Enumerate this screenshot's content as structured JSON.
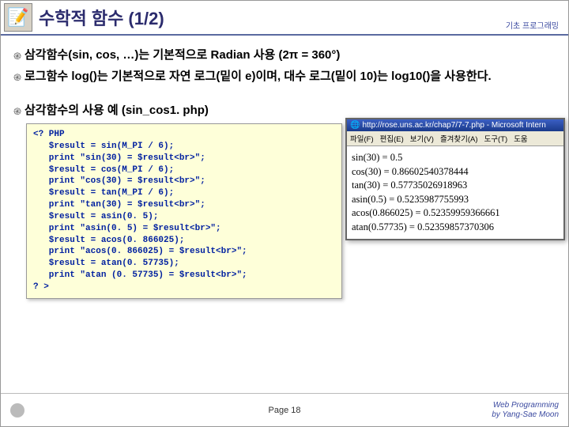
{
  "header": {
    "icon_glyph": "📝",
    "title": "수학적 함수 (1/2)",
    "subtitle": "기초 프로그래밍"
  },
  "bullets": {
    "b1": "삼각함수(sin, cos, …)는 기본적으로 Radian 사용 (2π = 360°)",
    "b2": "로그함수 log()는 기본적으로 자연 로그(밑이 e)이며, 대수 로그(밑이 10)는 log10()을 사용한다.",
    "b3": "삼각함수의 사용 예 (sin_cos1. php)"
  },
  "code": "<? PHP\n   $result = sin(M_PI / 6);\n   print \"sin(30) = $result<br>\";\n   $result = cos(M_PI / 6);\n   print \"cos(30) = $result<br>\";\n   $result = tan(M_PI / 6);\n   print \"tan(30) = $result<br>\";\n   $result = asin(0. 5);\n   print \"asin(0. 5) = $result<br>\";\n   $result = acos(0. 866025);\n   print \"acos(0. 866025) = $result<br>\";\n   $result = atan(0. 57735);\n   print \"atan (0. 57735) = $result<br>\";\n? >",
  "browser": {
    "title_text": "http://rose.uns.ac.kr/chap7/7-7.php - Microsoft Intern",
    "menu": {
      "m1": "파일(F)",
      "m2": "편집(E)",
      "m3": "보기(V)",
      "m4": "즐겨찾기(A)",
      "m5": "도구(T)",
      "m6": "도움"
    },
    "body": "sin(30) = 0.5\ncos(30) = 0.86602540378444\ntan(30) = 0.57735026918963\nasin(0.5) = 0.5235987755993\nacos(0.866025) = 0.52359959366661\natan(0.57735) = 0.52359857370306"
  },
  "footer": {
    "left_text": "",
    "center": "Page 18",
    "right_line1": "Web Programming",
    "right_line2": "by Yang-Sae Moon"
  }
}
